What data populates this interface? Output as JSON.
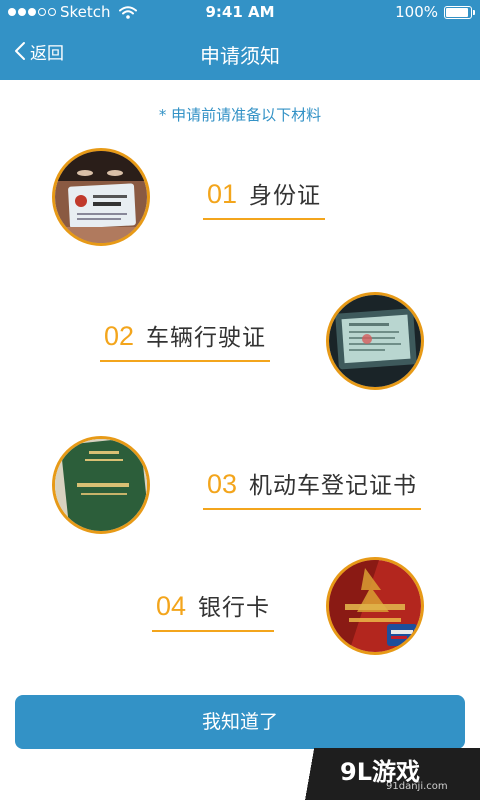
{
  "status_bar": {
    "carrier": "Sketch",
    "time": "9:41 AM",
    "battery": "100%",
    "battery_level": 1.0,
    "signal_filled": 3,
    "signal_total": 5,
    "icons": [
      "signal-dots-icon",
      "wifi-icon",
      "battery-icon"
    ]
  },
  "nav": {
    "back_label": "返回",
    "title": "申请须知"
  },
  "hint": "* 申请前请准备以下材料",
  "items": [
    {
      "num": "01",
      "label": "身份证",
      "image": "id-card-photo"
    },
    {
      "num": "02",
      "label": "车辆行驶证",
      "image": "vehicle-license-photo"
    },
    {
      "num": "03",
      "label": "机动车登记证书",
      "image": "registration-certificate-photo"
    },
    {
      "num": "04",
      "label": "银行卡",
      "image": "bank-card-photo"
    }
  ],
  "confirm_button": "我知道了",
  "watermark": {
    "logo": "9L游戏",
    "domain": "91danji.com"
  },
  "colors": {
    "accent": "#3392c6",
    "orange": "#f3a51c",
    "text": "#333333"
  }
}
